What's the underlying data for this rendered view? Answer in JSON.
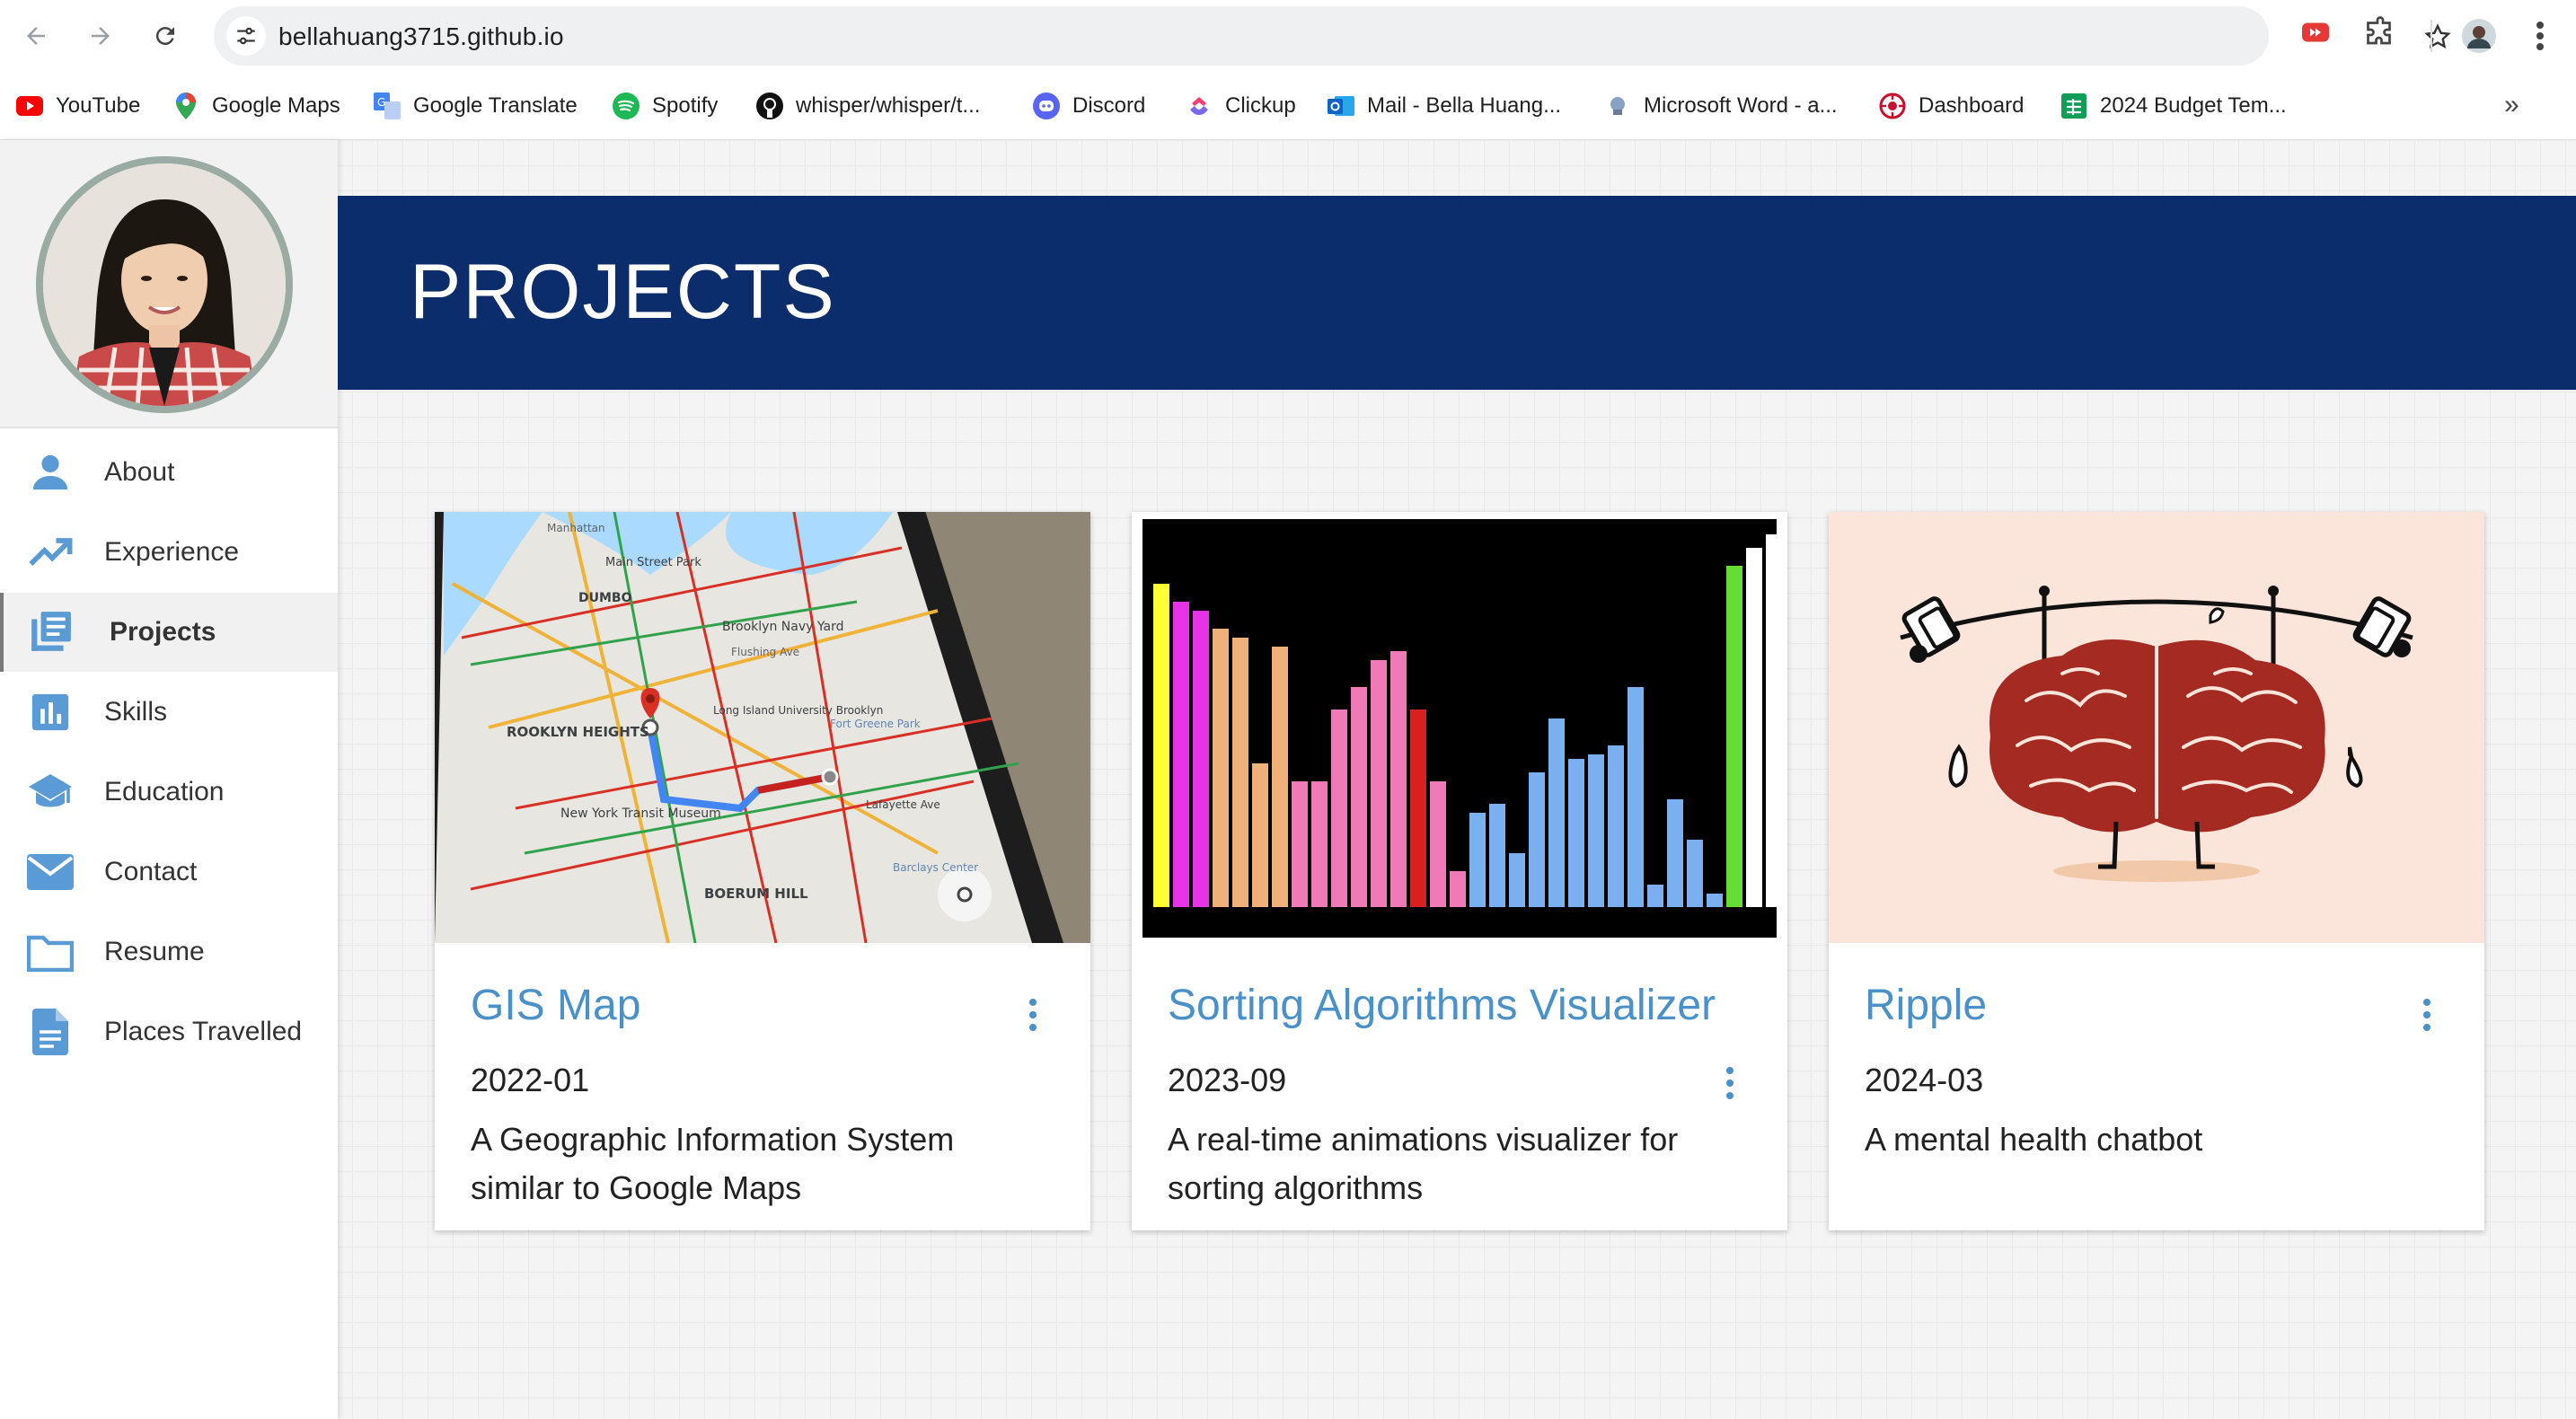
{
  "browser": {
    "url": "bellahuang3715.github.io",
    "bookmarks": [
      {
        "label": "YouTube",
        "icon": "youtube-icon",
        "color": "#ff0000"
      },
      {
        "label": "Google Maps",
        "icon": "google-maps-icon",
        "color": "#34a853"
      },
      {
        "label": "Google Translate",
        "icon": "google-translate-icon",
        "color": "#4285f4"
      },
      {
        "label": "Spotify",
        "icon": "spotify-icon",
        "color": "#1db954"
      },
      {
        "label": "whisper/whisper/t...",
        "icon": "github-icon",
        "color": "#111111"
      },
      {
        "label": "Discord",
        "icon": "discord-icon",
        "color": "#5865f2"
      },
      {
        "label": "Clickup",
        "icon": "clickup-icon",
        "color": "#7b68ee"
      },
      {
        "label": "Mail - Bella Huang...",
        "icon": "outlook-icon",
        "color": "#0a64c8"
      },
      {
        "label": "Microsoft Word - a...",
        "icon": "word-icon",
        "color": "#6b7a99"
      },
      {
        "label": "Dashboard",
        "icon": "dashboard-icon",
        "color": "#c8102e"
      },
      {
        "label": "2024 Budget Tem...",
        "icon": "sheets-icon",
        "color": "#0f9d58"
      }
    ],
    "more_label": "»"
  },
  "sidebar": {
    "items": [
      {
        "label": "About",
        "icon": "person-icon"
      },
      {
        "label": "Experience",
        "icon": "trending-up-icon"
      },
      {
        "label": "Projects",
        "icon": "library-books-icon",
        "active": true
      },
      {
        "label": "Skills",
        "icon": "bar-chart-icon"
      },
      {
        "label": "Education",
        "icon": "school-icon"
      },
      {
        "label": "Contact",
        "icon": "mail-icon"
      },
      {
        "label": "Resume",
        "icon": "folder-icon"
      },
      {
        "label": "Places Travelled",
        "icon": "document-icon"
      }
    ]
  },
  "banner": {
    "title": "PROJECTS"
  },
  "projects": [
    {
      "title": "GIS Map",
      "date": "2022-01",
      "description": "A Geographic Information System similar to Google Maps"
    },
    {
      "title": "Sorting Algorithms Visualizer",
      "date": "2023-09",
      "description": "A real-time animations visualizer for sorting algorithms"
    },
    {
      "title": "Ripple",
      "date": "2024-03",
      "description": "A mental health chatbot"
    }
  ],
  "map_labels": [
    "Manhattan",
    "Main Street Park",
    "DUMBO",
    "Brooklyn Navy Yard",
    "Flushing Ave",
    "ROOKLYN HEIGHTS",
    "Long Island University Brooklyn",
    "Fort Greene Park",
    "New York Transit Museum",
    "Lafayette Ave",
    "BOERUM HILL",
    "Barclays Center"
  ],
  "colors": {
    "accent": "#4a90c9",
    "banner": "#0c2d6b",
    "icon_blue": "#5b9bd5"
  }
}
